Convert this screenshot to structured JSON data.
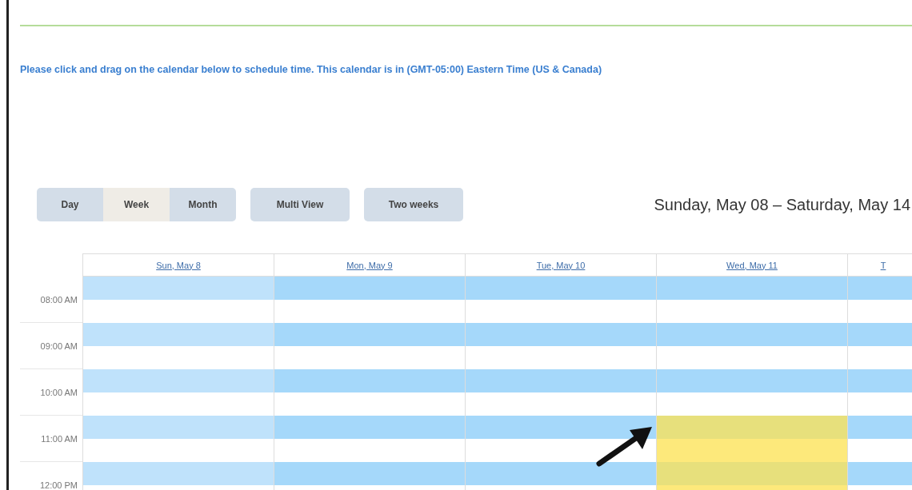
{
  "instruction": "Please click and drag on the calendar below to schedule time. This calendar is in (GMT-05:00) Eastern Time (US & Canada)",
  "views": [
    {
      "label": "Day",
      "selected": false
    },
    {
      "label": "Week",
      "selected": true
    },
    {
      "label": "Month",
      "selected": false
    }
  ],
  "buttons": [
    "Multi View",
    "Two weeks"
  ],
  "date_range": "Sunday, May 08 – Saturday, May 14",
  "days": [
    {
      "label": "Sun, May 8",
      "dimmed": true,
      "slots": [
        {
          "selected": false
        },
        {
          "selected": false
        },
        {
          "selected": false
        },
        {
          "selected": false
        },
        {
          "selected": false
        }
      ]
    },
    {
      "label": "Mon, May 9",
      "dimmed": false,
      "slots": [
        {
          "selected": false
        },
        {
          "selected": false
        },
        {
          "selected": false
        },
        {
          "selected": false
        },
        {
          "selected": false
        }
      ]
    },
    {
      "label": "Tue, May 10",
      "dimmed": false,
      "slots": [
        {
          "selected": false
        },
        {
          "selected": false
        },
        {
          "selected": false
        },
        {
          "selected": false
        },
        {
          "selected": false
        }
      ]
    },
    {
      "label": "Wed, May 11",
      "dimmed": false,
      "slots": [
        {
          "selected": false
        },
        {
          "selected": false
        },
        {
          "selected": false
        },
        {
          "selected": true
        },
        {
          "selected": true
        }
      ]
    },
    {
      "label": "T",
      "dimmed": false,
      "slots": [
        {
          "selected": false
        },
        {
          "selected": false
        },
        {
          "selected": false
        },
        {
          "selected": false
        },
        {
          "selected": false
        }
      ]
    }
  ],
  "hours": [
    "08:00 AM",
    "09:00 AM",
    "10:00 AM",
    "11:00 AM",
    "12:00 PM"
  ]
}
